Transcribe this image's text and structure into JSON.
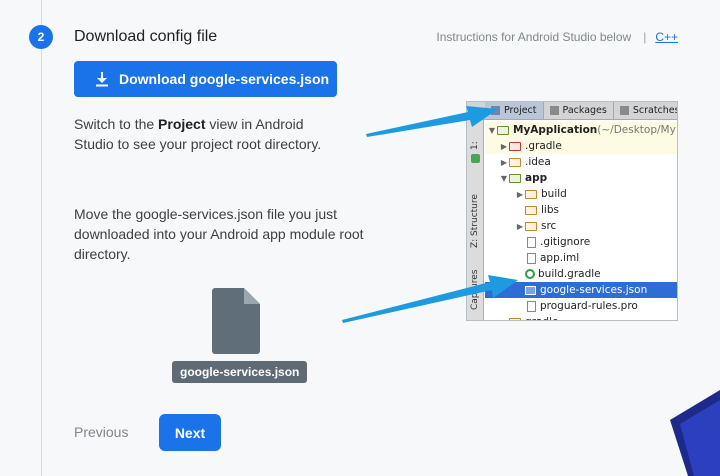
{
  "step": {
    "number": "2",
    "title": "Download config file",
    "instructions_text": "Instructions for Android Studio below",
    "separator": "|",
    "lang_link": "C++"
  },
  "download_button": {
    "label": "Download google-services.json",
    "icon": "download-icon"
  },
  "paragraph1": {
    "before": "Switch to the ",
    "bold": "Project",
    "after": " view in Android Studio to see your project root directory."
  },
  "paragraph2": "Move the google-services.json file you just downloaded into your Android app module root directory.",
  "file_chip": "google-services.json",
  "nav": {
    "previous": "Previous",
    "next": "Next"
  },
  "ide": {
    "tabs": [
      "Project",
      "Packages",
      "Scratches"
    ],
    "side_labels": [
      "1:",
      "Z: Structure",
      "Captures"
    ],
    "tree": [
      {
        "label": "MyApplication",
        "suffix": " (~/Desktop/My",
        "bold": true
      },
      {
        "label": ".gradle"
      },
      {
        "label": ".idea"
      },
      {
        "label": "app",
        "bold": true
      },
      {
        "label": "build"
      },
      {
        "label": "libs"
      },
      {
        "label": "src"
      },
      {
        "label": ".gitignore"
      },
      {
        "label": "app.iml"
      },
      {
        "label": "build.gradle"
      },
      {
        "label": "google-services.json"
      },
      {
        "label": "proguard-rules.pro"
      },
      {
        "label": "gradle"
      }
    ]
  },
  "colors": {
    "accent": "#1a73e8",
    "arrow": "#1e9be0",
    "selection": "#2f6dd6"
  }
}
